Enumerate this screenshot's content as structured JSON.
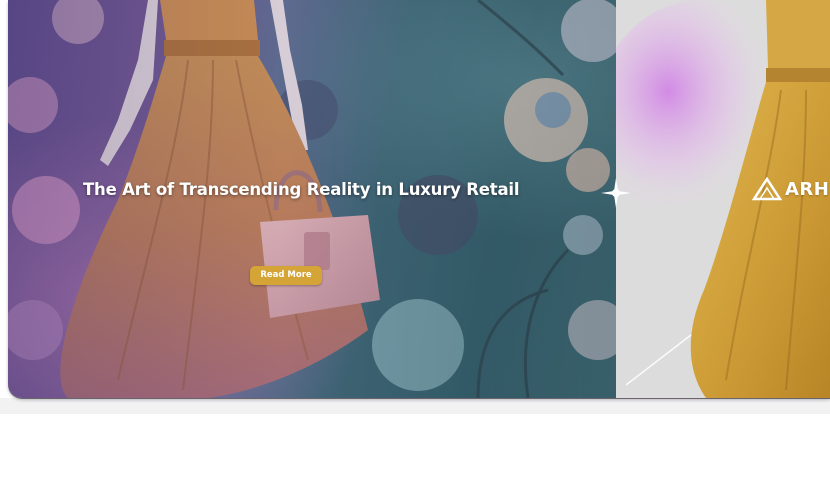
{
  "hero": {
    "title": "The Art of Transcending Reality in Luxury Retail",
    "cta_label": "Read More"
  },
  "next_slide": {
    "brand": "ARH"
  },
  "colors": {
    "cta_background": "#d4a437",
    "cta_text": "#ffffff",
    "title_text": "#ffffff",
    "page_background": "#ffffff"
  }
}
